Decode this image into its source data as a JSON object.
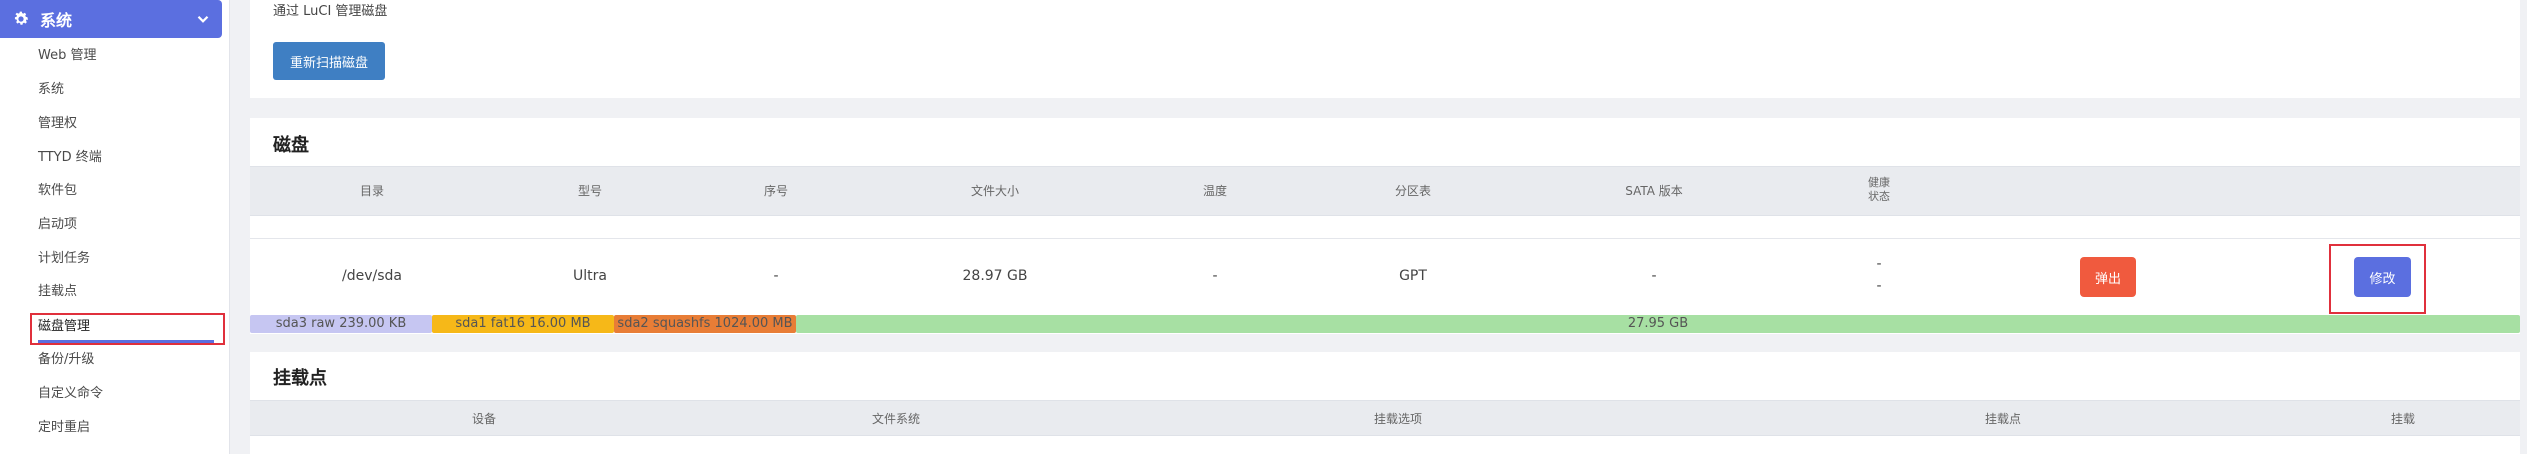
{
  "sidebar": {
    "header": "系统",
    "items": [
      {
        "label": "Web 管理"
      },
      {
        "label": "系统"
      },
      {
        "label": "管理权"
      },
      {
        "label": "TTYD 终端"
      },
      {
        "label": "软件包"
      },
      {
        "label": "启动项"
      },
      {
        "label": "计划任务"
      },
      {
        "label": "挂载点"
      },
      {
        "label": "磁盘管理"
      },
      {
        "label": "备份/升级"
      },
      {
        "label": "自定义命令"
      },
      {
        "label": "定时重启"
      }
    ],
    "active": "磁盘管理"
  },
  "main": {
    "description": "通过 LuCI 管理磁盘",
    "rescan_label": "重新扫描磁盘",
    "disk_section": {
      "title": "磁盘",
      "columns": [
        "目录",
        "型号",
        "序号",
        "文件大小",
        "温度",
        "分区表",
        "SATA 版本",
        "健康",
        "状态"
      ],
      "row": {
        "path": "/dev/sda",
        "model": "Ultra",
        "serial": "-",
        "size": "28.97 GB",
        "temp": "-",
        "partition_table": "GPT",
        "sata": "-",
        "health": "-",
        "status": "-",
        "eject_label": "弹出",
        "edit_label": "修改"
      },
      "partitions": [
        {
          "label": "sda3 raw 239.00 KB",
          "color": "#c6c6f2",
          "text_color": "#555"
        },
        {
          "label": "sda1 fat16 16.00 MB",
          "color": "#f6b818",
          "text_color": "#555"
        },
        {
          "label": "sda2 squashfs 1024.00 MB",
          "color": "#e87d36",
          "text_color": "#555"
        },
        {
          "label": "27.95 GB",
          "color": "#a7e0a3",
          "text_color": "#555"
        }
      ]
    },
    "mount_section": {
      "title": "挂载点",
      "columns": [
        "设备",
        "文件系统",
        "挂载选项",
        "挂载点",
        "挂载"
      ]
    }
  },
  "colors": {
    "accent": "#5b6fe0",
    "rescan": "#3f7fc3",
    "eject": "#f05a3e",
    "highlight": "#e0303c"
  }
}
